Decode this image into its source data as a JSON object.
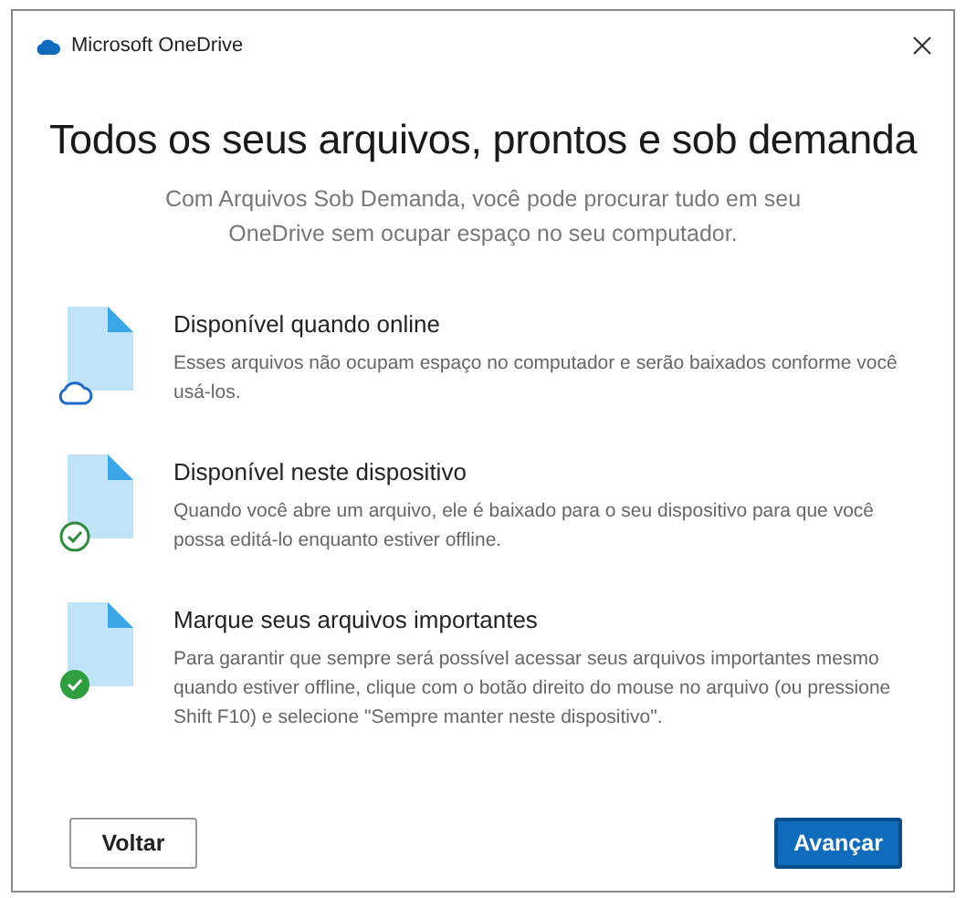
{
  "window": {
    "title": "Microsoft OneDrive"
  },
  "heading": "Todos os seus arquivos, prontos e sob demanda",
  "subtitle": "Com Arquivos Sob Demanda, você pode procurar tudo em seu OneDrive sem ocupar espaço no seu computador.",
  "features": [
    {
      "kind": "cloud",
      "title": "Disponível quando online",
      "description": "Esses arquivos não ocupam espaço no computador e serão baixados conforme você usá-los."
    },
    {
      "kind": "check-outline",
      "title": "Disponível neste dispositivo",
      "description": "Quando você abre um arquivo, ele é baixado para o seu dispositivo para que você possa editá-lo enquanto estiver offline."
    },
    {
      "kind": "check-filled",
      "title": "Marque seus arquivos importantes",
      "description": "Para garantir que sempre será possível acessar seus arquivos importantes mesmo quando estiver offline, clique com o botão direito do mouse no arquivo (ou pressione Shift F10) e selecione \"Sempre manter neste dispositivo\"."
    }
  ],
  "buttons": [
    {
      "label": "Voltar",
      "kind": "secondary"
    },
    {
      "label": "Avançar",
      "kind": "primary"
    }
  ]
}
